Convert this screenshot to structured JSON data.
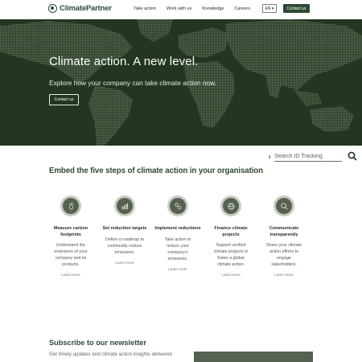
{
  "header": {
    "logo_text": "ClimatePartner",
    "nav": [
      "Take action",
      "Work with us",
      "Knowledge",
      "Careers"
    ],
    "lang": "EN ▾",
    "contact_label": "Contact us"
  },
  "hero": {
    "title": "Climate action. A new level.",
    "subtitle": "Explore how your company can take climate action now.",
    "cta": "Contact us"
  },
  "search": {
    "placeholder": "Search ID Tracking"
  },
  "steps": {
    "title": "Embed the five steps of climate action in your organisation",
    "items": [
      {
        "title": "Measure carbon footprints",
        "desc": "Understand the emissions of your company and its products.",
        "link": "Learn more",
        "icon": "footprint-icon"
      },
      {
        "title": "Set reduction targets",
        "desc": "Define a roadmap to continually reduce emissions.",
        "link": "Learn more",
        "icon": "target-chart-icon"
      },
      {
        "title": "Implement reductions",
        "desc": "Take action to reduce your company's emissions.",
        "link": "Learn more",
        "icon": "reduction-icon"
      },
      {
        "title": "Finance climate projects",
        "desc": "Support verified climate projects to foster a global climate action.",
        "link": "Learn more",
        "icon": "globe-icon"
      },
      {
        "title": "Communicate transparently",
        "desc": "Share your climate action efforts to engage stakeholders.",
        "link": "Learn more",
        "icon": "magnifier-icon"
      }
    ]
  },
  "newsletter": {
    "title": "Subscribe to our newsletter",
    "subtitle": "Get timely updates and climate action insights delivered"
  },
  "colors": {
    "brand": "#2f4a33",
    "hero_bg": "#23361f",
    "map": "#5a6c55"
  }
}
